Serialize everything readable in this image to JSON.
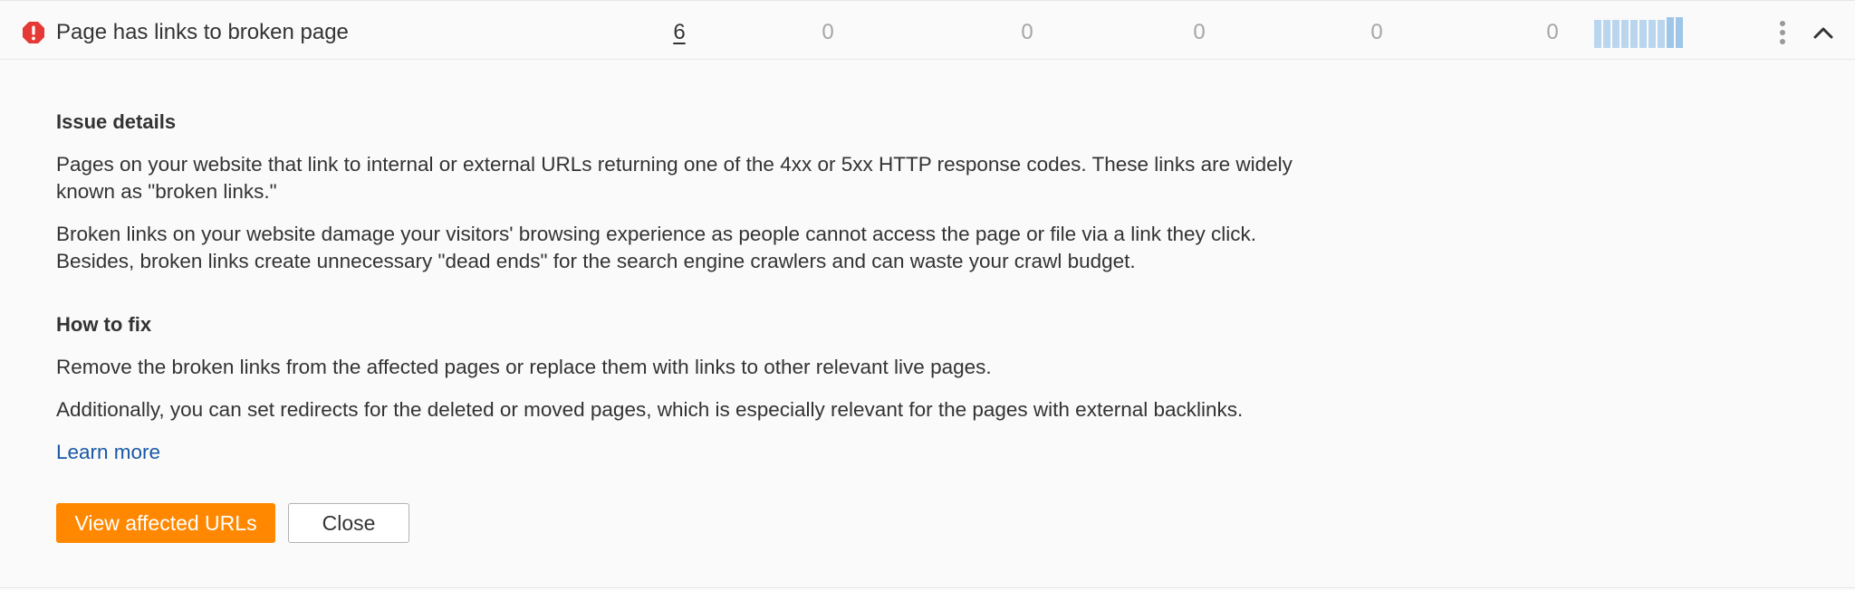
{
  "issue_row": {
    "icon": "error-exclamation-icon",
    "title": "Page has links to broken page",
    "values": [
      "6",
      "0",
      "0",
      "0",
      "0",
      "0"
    ],
    "trend": [
      9,
      9,
      9,
      9,
      9,
      9,
      9,
      9,
      10,
      10
    ],
    "actions_icon": "kebab-menu-icon",
    "collapse_icon": "chevron-up-icon"
  },
  "details": {
    "heading": "Issue details",
    "paragraph1_line1": "Pages on your website that link to internal or external URLs returning one of the 4xx or 5xx HTTP response codes. These links are widely",
    "paragraph1_line2": "known as \"broken links.\"",
    "paragraph2_line1": "Broken links on your website damage your visitors' browsing experience as people cannot access the page or file via a link they click.",
    "paragraph2_line2": "Besides, broken links create unnecessary \"dead ends\" for the search engine crawlers and can waste your crawl budget."
  },
  "fix": {
    "heading": "How to fix",
    "paragraph1": "Remove the broken links from the affected pages or replace them with links to other relevant live pages.",
    "paragraph2": "Additionally, you can set redirects for the deleted or moved pages, which is especially relevant for the pages with external backlinks."
  },
  "learn_more": "Learn more",
  "buttons": {
    "view": "View affected URLs",
    "close": "Close"
  },
  "colors": {
    "error": "#e53935",
    "accent": "#ff8800",
    "link": "#1a58a6",
    "spark": "#b9d6ee"
  }
}
